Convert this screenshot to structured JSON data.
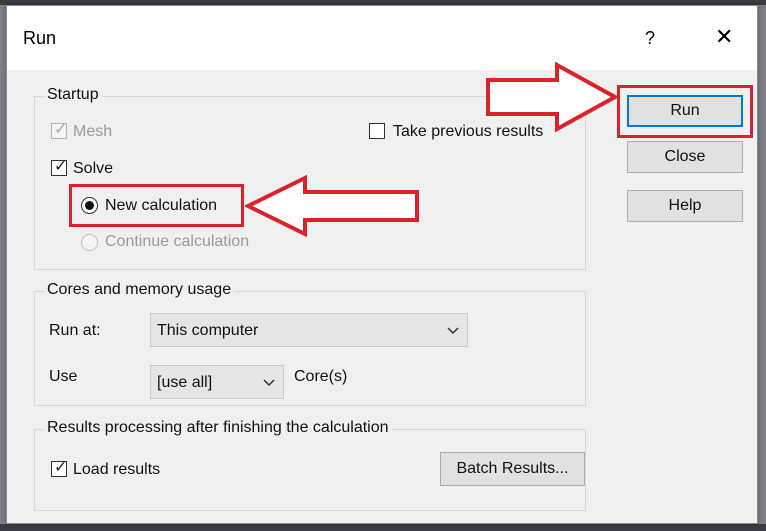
{
  "window": {
    "title": "Run",
    "help_glyph": "?",
    "close_glyph": "✕"
  },
  "startup": {
    "legend": "Startup",
    "mesh_label": "Mesh",
    "mesh_checked": true,
    "solve_label": "Solve",
    "solve_checked": true,
    "new_calc_label": "New calculation",
    "new_calc_selected": true,
    "continue_calc_label": "Continue calculation",
    "take_prev_label": "Take previous results",
    "take_prev_checked": false
  },
  "cores": {
    "legend": "Cores and memory usage",
    "run_at_label": "Run at:",
    "run_at_value": "This computer",
    "use_label": "Use",
    "use_value": "[use all]",
    "cores_suffix": "Core(s)"
  },
  "results": {
    "legend": "Results processing after finishing the calculation",
    "load_label": "Load results",
    "load_checked": true,
    "batch_button": "Batch Results..."
  },
  "buttons": {
    "run": "Run",
    "close": "Close",
    "help": "Help"
  },
  "annotations": {
    "highlight_color": "#d9222a"
  },
  "icons": {
    "check": "check-icon",
    "chevron": "chevron-down-icon",
    "close": "close-icon",
    "help": "help-icon",
    "arrow": "arrow-right-icon",
    "arrow_left": "arrow-left-icon"
  }
}
